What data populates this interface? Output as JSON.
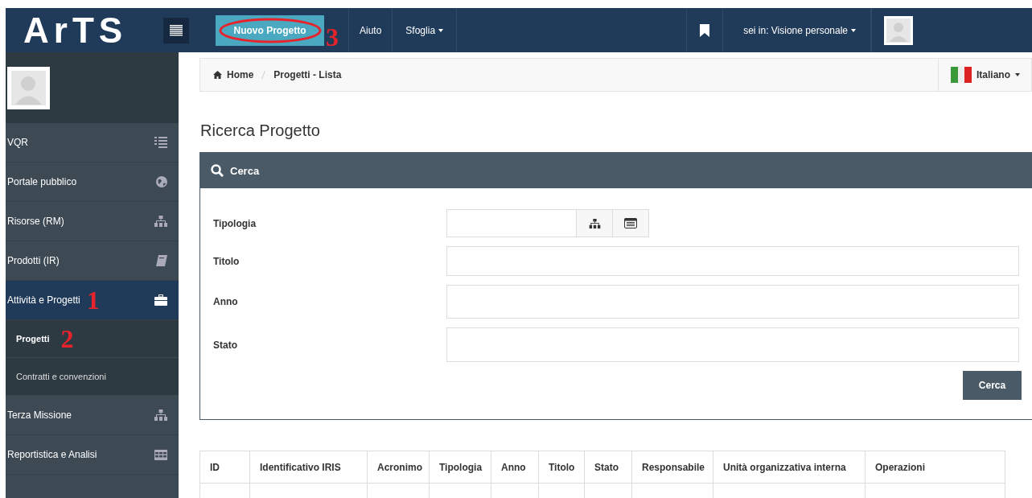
{
  "header": {
    "logo": "ArTS",
    "new_button": {
      "label": "Nuovo Progetto",
      "circled": true,
      "annotation": "3"
    },
    "menu": [
      {
        "label": "Aiuto",
        "dropdown": false
      },
      {
        "label": "Sfoglia",
        "dropdown": true
      }
    ],
    "context": {
      "label": "sei in: Visione personale",
      "dropdown": true
    }
  },
  "sidebar": {
    "items": [
      {
        "label": "VQR",
        "kind": "list",
        "selected": false
      },
      {
        "label": "Portale pubblico",
        "kind": "globe",
        "selected": false
      },
      {
        "label": "Risorse (RM)",
        "kind": "sitemap",
        "selected": false
      },
      {
        "label": "Prodotti (IR)",
        "kind": "book",
        "selected": false
      },
      {
        "label": "Attività e Progetti",
        "kind": "briefcase",
        "selected": true,
        "annotation": "1",
        "children": [
          {
            "label": "Progetti",
            "selected": true,
            "annotation": "2"
          },
          {
            "label": "Contratti e convenzioni",
            "selected": false
          }
        ]
      },
      {
        "label": "Terza Missione",
        "kind": "sitemap",
        "selected": false
      },
      {
        "label": "Reportistica e Analisi",
        "kind": "table",
        "selected": false
      }
    ]
  },
  "breadcrumb": [
    "Home",
    "Progetti - Lista"
  ],
  "language": "Italiano",
  "title": "Ricerca Progetto",
  "search_panel": {
    "title": "Cerca",
    "fields": [
      {
        "label": "Tipologia",
        "kind": "picker"
      },
      {
        "label": "Titolo",
        "kind": "text"
      },
      {
        "label": "Anno",
        "kind": "text"
      },
      {
        "label": "Stato",
        "kind": "select"
      }
    ],
    "button": "Cerca"
  },
  "table": {
    "columns": [
      "ID",
      "Identificativo IRIS",
      "Acronimo",
      "Tipologia",
      "Anno",
      "Titolo",
      "Stato",
      "Responsabile",
      "Unità organizzativa interna",
      "Operazioni"
    ]
  }
}
